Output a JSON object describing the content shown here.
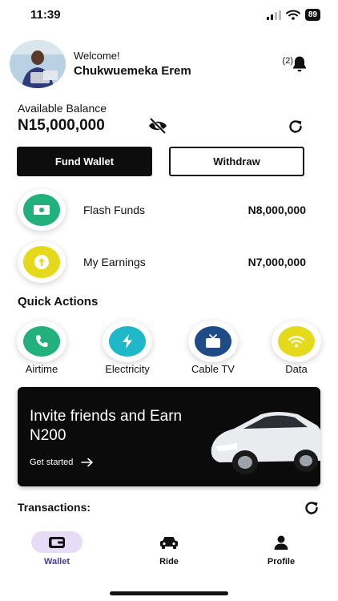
{
  "status_bar": {
    "time": "11:39",
    "battery": "89"
  },
  "header": {
    "welcome": "Welcome!",
    "username": "Chukwuemeka Erem",
    "notification_count": "(2)"
  },
  "balance": {
    "label": "Available Balance",
    "amount": "N15,000,000"
  },
  "buttons": {
    "fund_wallet": "Fund Wallet",
    "withdraw": "Withdraw"
  },
  "funds": [
    {
      "name": "Flash Funds",
      "amount": "N8,000,000",
      "icon": "cash-icon",
      "color": "#22b07d"
    },
    {
      "name": "My Earnings",
      "amount": "N7,000,000",
      "icon": "arrow-up-circle-icon",
      "color": "#e5d91c"
    }
  ],
  "quick_actions": {
    "title": "Quick Actions",
    "items": [
      {
        "label": "Airtime",
        "icon": "phone-icon",
        "color": "#22b07d"
      },
      {
        "label": "Electricity",
        "icon": "bolt-icon",
        "color": "#1fb8c9"
      },
      {
        "label": "Cable TV",
        "icon": "tv-icon",
        "color": "#1f4c86"
      },
      {
        "label": "Data",
        "icon": "wifi-icon",
        "color": "#e5d91c"
      }
    ]
  },
  "banner": {
    "title": "Invite friends and Earn N200",
    "cta": "Get started"
  },
  "transactions": {
    "title": "Transactions:"
  },
  "nav": [
    {
      "label": "Wallet",
      "icon": "wallet-icon",
      "active": true
    },
    {
      "label": "Ride",
      "icon": "car-icon",
      "active": false
    },
    {
      "label": "Profile",
      "icon": "person-icon",
      "active": false
    }
  ],
  "colors": {
    "primary": "#0d0d0d",
    "nav_active_bg": "#e6dcf6",
    "nav_active_text": "#4a3f8c"
  }
}
